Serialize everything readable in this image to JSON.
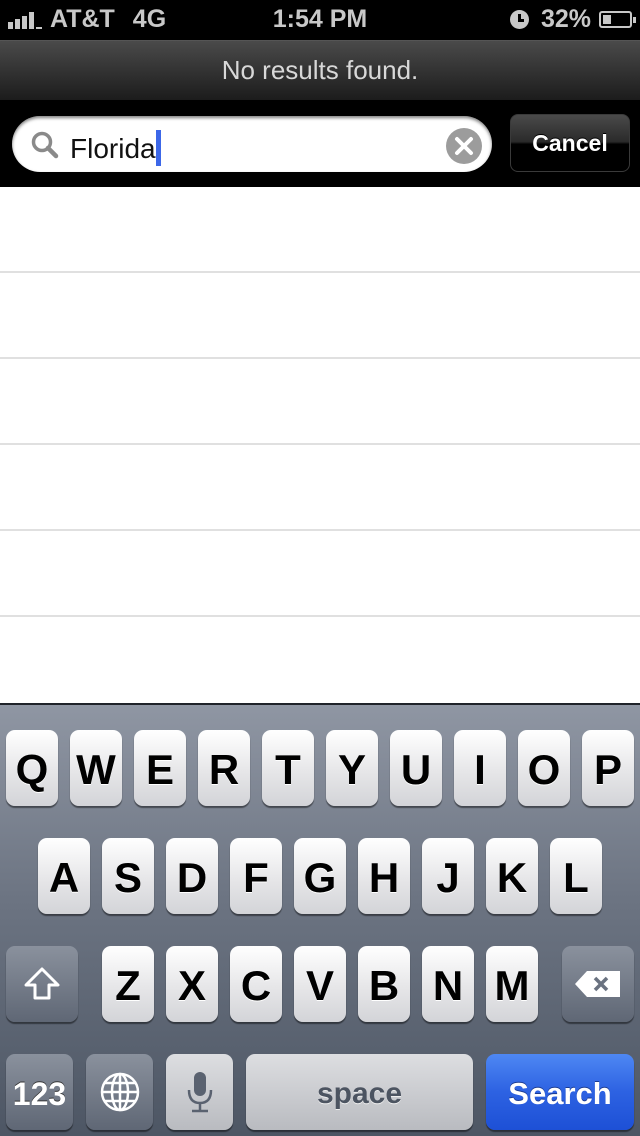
{
  "status_bar": {
    "carrier": "AT&T",
    "network": "4G",
    "time": "1:54 PM",
    "battery_percent": "32%",
    "battery_level": 0.32,
    "signal_bars": 4,
    "icons": [
      "signal-icon",
      "alarm-icon",
      "battery-icon"
    ]
  },
  "header": {
    "message": "No results found."
  },
  "search": {
    "value": "Florida",
    "placeholder": "",
    "cancel_label": "Cancel",
    "icons": [
      "magnifier-icon",
      "clear-icon"
    ]
  },
  "results": {
    "rows": [
      "",
      "",
      "",
      "",
      "",
      "",
      ""
    ]
  },
  "keyboard": {
    "row1": [
      "Q",
      "W",
      "E",
      "R",
      "T",
      "Y",
      "U",
      "I",
      "O",
      "P"
    ],
    "row2": [
      "A",
      "S",
      "D",
      "F",
      "G",
      "H",
      "J",
      "K",
      "L"
    ],
    "row3": [
      "Z",
      "X",
      "C",
      "V",
      "B",
      "N",
      "M"
    ],
    "numbers_label": "123",
    "space_label": "space",
    "return_label": "Search",
    "icons": [
      "shift-icon",
      "backspace-icon",
      "globe-icon",
      "microphone-icon"
    ],
    "accent_color": "#2d62e2"
  }
}
